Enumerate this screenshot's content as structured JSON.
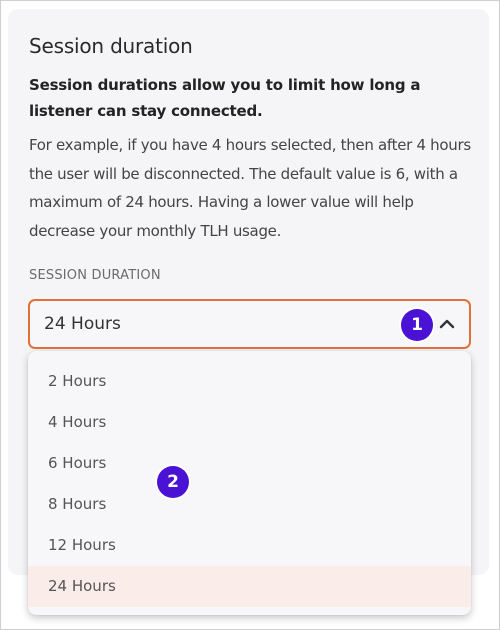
{
  "title": "Session duration",
  "lead": "Session durations allow you to limit how long a listener can stay connected.",
  "description": "For example, if you have 4 hours selected, then after 4 hours the user will be disconnected. The default value is 6, with a maximum of 24 hours. Having a lower value will help decrease your monthly TLH usage.",
  "field": {
    "label": "SESSION DURATION",
    "selected": "24 Hours"
  },
  "options": [
    "2 Hours",
    "4 Hours",
    "6 Hours",
    "8 Hours",
    "12 Hours",
    "24 Hours"
  ],
  "markers": [
    "1",
    "2"
  ],
  "icons": {
    "dropdown": "chevron-up-icon"
  },
  "colors": {
    "accent_border": "#e0713a",
    "marker": "#4a12d4",
    "selected_option_bg": "#f9ece9"
  }
}
